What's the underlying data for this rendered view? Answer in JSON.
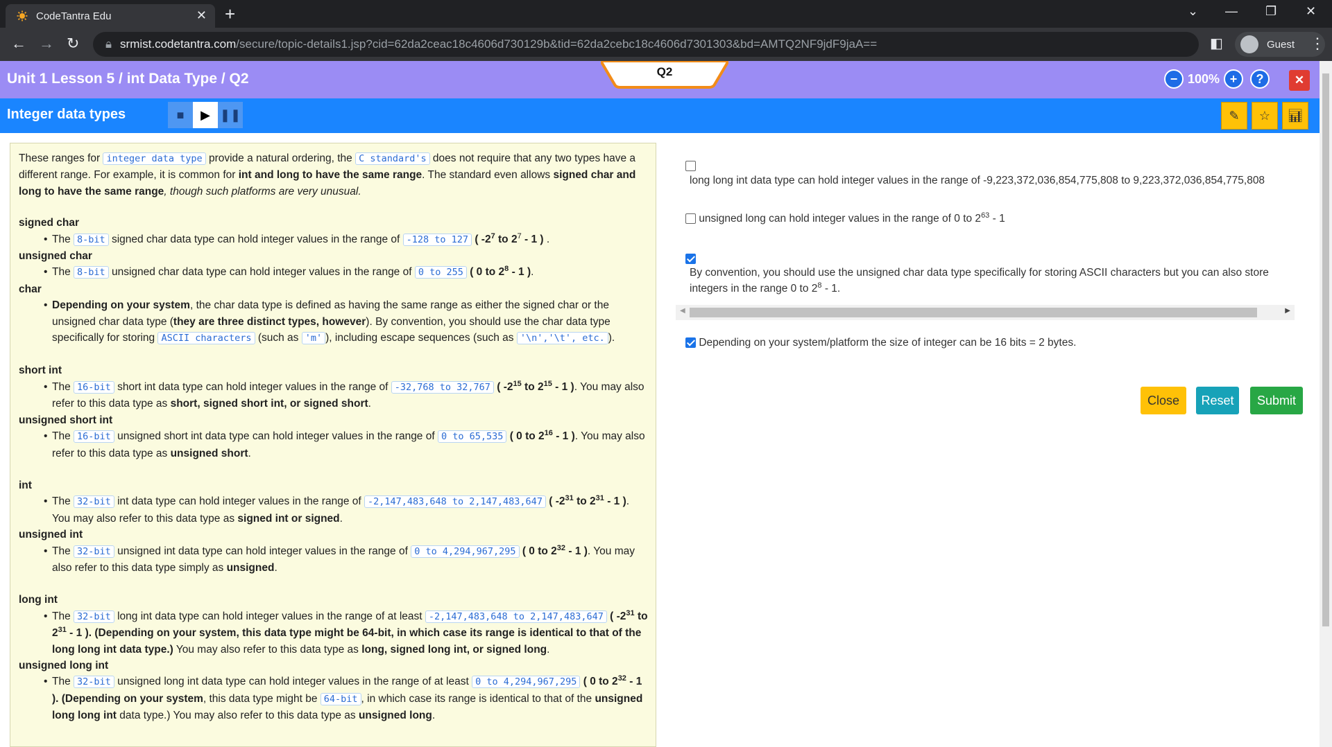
{
  "browser": {
    "tab_title": "CodeTantra Edu",
    "url_host": "srmist.codetantra.com",
    "url_path": "/secure/topic-details1.jsp?cid=62da2ceac18c4606d730129b&tid=62da2cebc18c4606d7301303&bd=AMTQ2NF9jdF9jaA==",
    "profile_label": "Guest"
  },
  "header": {
    "breadcrumb": "Unit 1 Lesson 5 / int Data Type / Q2",
    "question_tab": "Q2",
    "zoom": "100%",
    "topic_title": "Integer data types"
  },
  "lesson": {
    "intro": {
      "t1": "These ranges for ",
      "c1": "integer data type",
      "t2": " provide a natural ordering, the ",
      "c2": "C standard's",
      "t3": " does not require that any two types have a different range. For example, it is common for ",
      "b1": "int and long to have the same range",
      "t4": ". The standard even allows ",
      "b2": "signed char and long to have the same range",
      "i1": ", though such platforms are very unusual."
    },
    "signed_char": {
      "heading": "signed char",
      "t1": "The ",
      "c1": "8-bit",
      "t2": " signed char data type can hold integer values in the range of ",
      "c2": "-128 to 127",
      "b1": " ( -2",
      "s1": "7",
      "b2": " to 2",
      "s2": "7",
      "b3": " - 1 )",
      "t3": " ."
    },
    "unsigned_char": {
      "heading": "unsigned char",
      "t1": "The ",
      "c1": "8-bit",
      "t2": " unsigned char data type can hold integer values in the range of ",
      "c2": "0 to 255",
      "b1": " ( 0 to 2",
      "s1": "8",
      "b2": " - 1 )",
      "t3": "."
    },
    "char": {
      "heading": "char",
      "b1": "Depending on your system",
      "t1": ", the char data type is defined as having the same range as either the signed char or the unsigned char data type (",
      "b2": "they are three distinct types, however",
      "t2": "). By convention, you should use the char data type specifically for storing ",
      "c1": "ASCII characters",
      "t3": " (such as ",
      "c2": "'m'",
      "t4": "), including escape sequences (such as ",
      "c3": "'\\n','\\t', etc.",
      "t5": ")."
    },
    "short_int": {
      "heading": "short int",
      "t1": "The ",
      "c1": "16-bit",
      "t2": " short int data type can hold integer values in the range of ",
      "c2": "-32,768 to 32,767",
      "b1": " ( -2",
      "s1": "15",
      "b2": " to 2",
      "s2": "15",
      "b3": " - 1 )",
      "t3": ". You may also refer to this data type as ",
      "b4": "short, signed short int, or signed short",
      "t4": "."
    },
    "unsigned_short_int": {
      "heading": "unsigned short int",
      "t1": "The ",
      "c1": "16-bit",
      "t2": " unsigned short int data type can hold integer values in the range of ",
      "c2": "0 to 65,535",
      "b1": " ( 0 to 2",
      "s1": "16",
      "b2": " - 1 )",
      "t3": ". You may also refer to this data type as ",
      "b3": "unsigned short",
      "t4": "."
    },
    "int": {
      "heading": "int",
      "t1": "The ",
      "c1": "32-bit",
      "t2": " int data type can hold integer values in the range of ",
      "c2": "-2,147,483,648 to 2,147,483,647",
      "b1": " ( -2",
      "s1": "31",
      "b2": " to 2",
      "s2": "31",
      "b3": " - 1 )",
      "t3": ". You may also refer to this data type as ",
      "b4": "signed int or signed",
      "t4": "."
    },
    "unsigned_int": {
      "heading": "unsigned int",
      "t1": "The ",
      "c1": "32-bit",
      "t2": " unsigned int data type can hold integer values in the range of ",
      "c2": "0 to 4,294,967,295",
      "b1": " ( 0 to 2",
      "s1": "32",
      "b2": " - 1 )",
      "t3": ". You may also refer to this data type simply as ",
      "b3": "unsigned",
      "t4": "."
    },
    "long_int": {
      "heading": "long int",
      "t1": "The ",
      "c1": "32-bit",
      "t2": " long int data type can hold integer values in the range of at least ",
      "c2": "-2,147,483,648 to 2,147,483,647",
      "b1": " ( -2",
      "s1": "31",
      "b2": " to 2",
      "s2": "31",
      "b3": " - 1 ). (Depending on your system, this data type might be 64-bit, in which case its range is identical to that of the long long int data type.)",
      "t3": " You may also refer to this data type as ",
      "b4": "long, signed long int, or signed long",
      "t4": "."
    },
    "unsigned_long_int": {
      "heading": "unsigned long int",
      "t1": "The ",
      "c1": "32-bit",
      "t2": " unsigned long int data type can hold integer values in the range of at least ",
      "c2": "0 to 4,294,967,295",
      "b1": " ( 0 to 2",
      "s1": "32",
      "b2": " - 1 ). (Depending on your system",
      "t3": ", this data type might be ",
      "c3": "64-bit",
      "t4": ", in which case its range is identical to that of the ",
      "b3": "unsigned long long int",
      "t5": " data type.) You may also refer to this data type as ",
      "b4": "unsigned long",
      "t6": "."
    }
  },
  "options": [
    {
      "text": "long long int data type can hold integer values in the range of -9,223,372,036,854,775,808 to 9,223,372,036,854,775,808",
      "checked": false
    },
    {
      "text_a": "unsigned long can hold integer values in the range of 0 to 2",
      "sup": "63",
      "text_b": " - 1",
      "checked": false
    },
    {
      "text_a": "By convention, you should use the unsigned char data type specifically for storing ASCII characters but you can also store integers in the range 0 to 2",
      "sup": "8",
      "text_b": " - 1.",
      "checked": true
    },
    {
      "text": "Depending on your system/platform the size of integer can be 16 bits = 2 bytes.",
      "checked": true
    }
  ],
  "buttons": {
    "close": "Close",
    "reset": "Reset",
    "submit": "Submit"
  },
  "colors": {
    "purple_header": "#9b8cf4",
    "blue_header": "#1a85ff",
    "close_btn": "#ffc107",
    "reset_btn": "#17a2b8",
    "submit_btn": "#28a745"
  }
}
